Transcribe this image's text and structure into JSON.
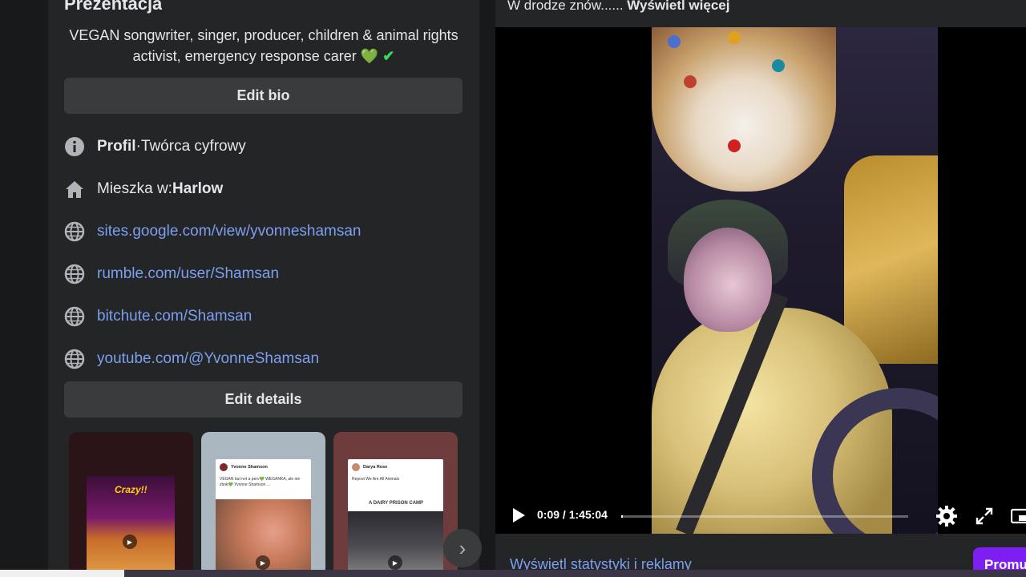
{
  "intro": {
    "title": "Prezentacja",
    "bio_text": "VEGAN songwriter, singer, producer, children & animal rights activist, emergency response carer",
    "bio_emoji_heart": "💚",
    "bio_emoji_check": "✔",
    "edit_bio_label": "Edit bio",
    "edit_details_label": "Edit details",
    "profile_label": "Profil",
    "profile_sep": " · ",
    "profile_value": "Twórca cyfrowy",
    "lives_prefix": "Mieszka w: ",
    "lives_city": "Harlow",
    "links": [
      "sites.google.com/view/yvonneshamsan",
      "rumble.com/user/Shamsan",
      "bitchute.com/Shamsan",
      "youtube.com/@YvonneShamsan"
    ]
  },
  "stories": [
    {
      "caption": "Crazy!!"
    },
    {
      "author": "Yvonne Shamson",
      "text": "VEGAN but not a perv💚 WEGANKA, ale nie zbok💚 Yvonne Shamson ..."
    },
    {
      "author": "Darya Rose",
      "text": "Repost We Are All Animals",
      "headline": "A DAIRY PRISON CAMP"
    }
  ],
  "viewer": {
    "caption_text": "W drodze znów...... ",
    "caption_more": "Wyświetl więcej",
    "time_current": "0:09",
    "time_sep": " / ",
    "time_total": "1:45:04",
    "progress": 0.0014,
    "stats_link": "Wyświetl statystyki i reklamy",
    "promo_label": "Promu"
  },
  "colors": {
    "link": "#7c9ff0",
    "promo": "#7d1ff2",
    "panel": "#242526",
    "button": "#3a3b3c"
  },
  "icons": [
    "info-icon",
    "home-icon",
    "globe-icon",
    "play-icon",
    "settings-icon",
    "fullscreen-icon",
    "pip-icon",
    "chevron-right-icon"
  ]
}
